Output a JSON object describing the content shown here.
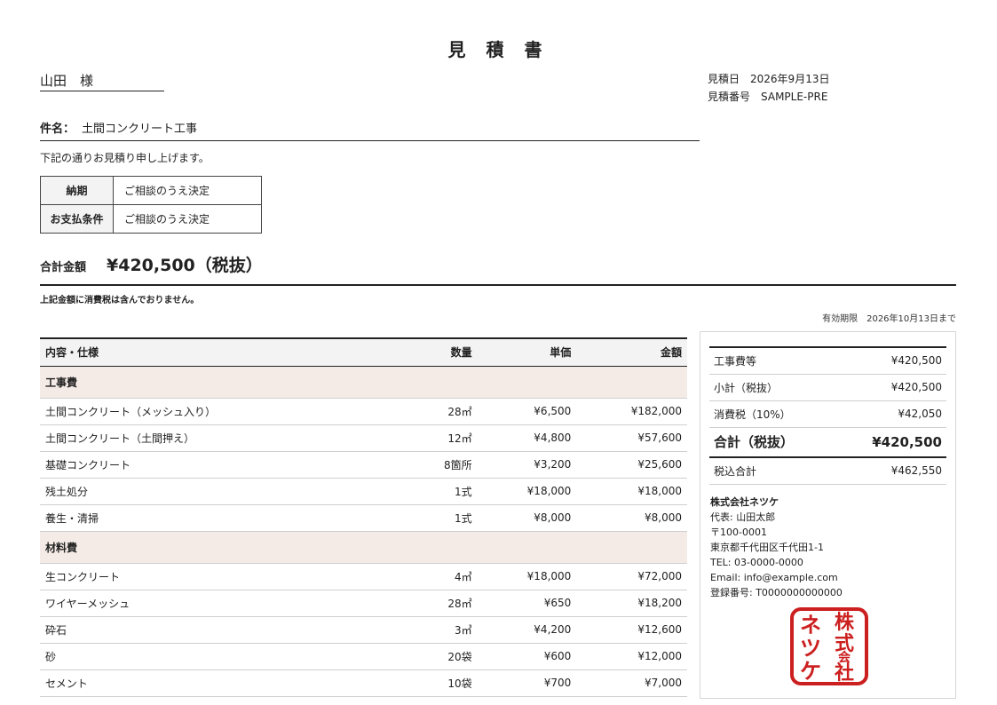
{
  "document": {
    "title": "見 積 書",
    "recipient": "山田　様",
    "estimate_date_label": "見積日",
    "estimate_date": "2026年9月13日",
    "estimate_no_label": "見積番号",
    "estimate_no": "SAMPLE-PRE",
    "subject_label": "件名：",
    "subject": "土間コンクリート工事",
    "intro": "下記の通りお見積り申し上げます。",
    "terms": [
      {
        "label": "納期",
        "value": "ご相談のうえ決定"
      },
      {
        "label": "お支払条件",
        "value": "ご相談のうえ決定"
      }
    ],
    "total_label": "合計金額",
    "total_amount": "¥420,500（税抜）",
    "tax_note": "上記金額に消費税は含んでおりません。",
    "validity_label": "有効期限",
    "validity_date": "2026年10月13日まで"
  },
  "items_table": {
    "headers": {
      "name": "内容・仕様",
      "qty": "数量",
      "price": "単価",
      "amount": "金額"
    },
    "categories": [
      {
        "name": "工事費",
        "rows": [
          {
            "name": "土間コンクリート（メッシュ入り）",
            "qty": "28㎡",
            "price": "¥6,500",
            "amount": "¥182,000"
          },
          {
            "name": "土間コンクリート（土間押え）",
            "qty": "12㎡",
            "price": "¥4,800",
            "amount": "¥57,600"
          },
          {
            "name": "基礎コンクリート",
            "qty": "8箇所",
            "price": "¥3,200",
            "amount": "¥25,600"
          },
          {
            "name": "残土処分",
            "qty": "1式",
            "price": "¥18,000",
            "amount": "¥18,000"
          },
          {
            "name": "養生・清掃",
            "qty": "1式",
            "price": "¥8,000",
            "amount": "¥8,000"
          }
        ]
      },
      {
        "name": "材料費",
        "rows": [
          {
            "name": "生コンクリート",
            "qty": "4㎥",
            "price": "¥18,000",
            "amount": "¥72,000"
          },
          {
            "name": "ワイヤーメッシュ",
            "qty": "28㎡",
            "price": "¥650",
            "amount": "¥18,200"
          },
          {
            "name": "砕石",
            "qty": "3㎥",
            "price": "¥4,200",
            "amount": "¥12,600"
          },
          {
            "name": "砂",
            "qty": "20袋",
            "price": "¥600",
            "amount": "¥12,000"
          },
          {
            "name": "セメント",
            "qty": "10袋",
            "price": "¥700",
            "amount": "¥7,000"
          }
        ]
      }
    ]
  },
  "summary": {
    "rows": [
      {
        "label": "工事費等",
        "value": "¥420,500"
      },
      {
        "label": "小計（税抜）",
        "value": "¥420,500"
      },
      {
        "label": "消費税（10%）",
        "value": "¥42,050"
      }
    ],
    "grand_label": "合計（税抜）",
    "grand_value": "¥420,500",
    "tax_incl_label": "税込合計",
    "tax_incl_value": "¥462,550"
  },
  "company": {
    "name": "株式会社ネツケ",
    "representative": "代表: 山田太郎",
    "postal": "〒100-0001",
    "address": "東京都千代田区千代田1-1",
    "tel": "TEL: 03-0000-0000",
    "email": "Email: info@example.com",
    "registration": "登録番号: T0000000000000",
    "seal_lines": [
      "株式",
      "会社",
      "ネツケ"
    ],
    "seal_color": "#cc1f1f"
  }
}
